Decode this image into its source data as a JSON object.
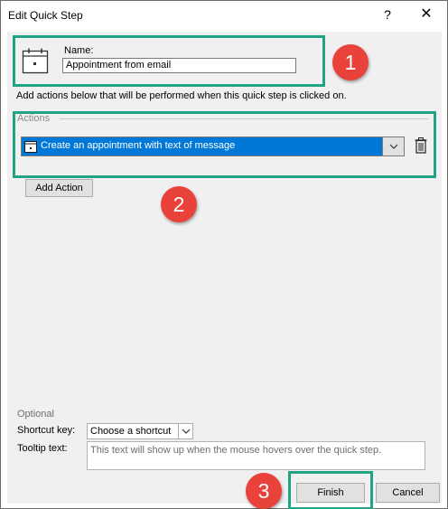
{
  "dialog": {
    "title": "Edit Quick Step",
    "help_glyph": "?",
    "close_glyph": "✕"
  },
  "name_section": {
    "icon": "calendar-icon",
    "label": "Name:",
    "value": "Appointment from email"
  },
  "hint_text": "Add actions below that will be performed when this quick step is clicked on.",
  "actions": {
    "legend": "Actions",
    "items": [
      {
        "icon": "calendar-icon",
        "label": "Create an appointment with text of message"
      }
    ],
    "delete_icon": "trash-icon",
    "add_button_label": "Add Action"
  },
  "optional": {
    "legend": "Optional",
    "shortcut_label": "Shortcut key:",
    "shortcut_value": "Choose a shortcut",
    "tooltip_label": "Tooltip text:",
    "tooltip_placeholder": "This text will show up when the mouse hovers over the quick step."
  },
  "buttons": {
    "finish": "Finish",
    "cancel": "Cancel"
  },
  "callouts": [
    "1",
    "2",
    "3"
  ],
  "colors": {
    "highlight": "#22a386",
    "badge": "#e9423a",
    "selection": "#0078d7"
  }
}
